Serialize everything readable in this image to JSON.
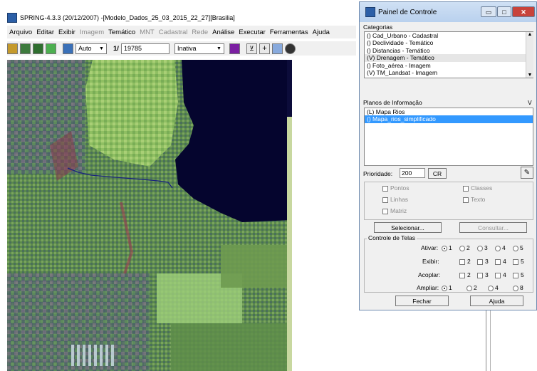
{
  "main_window": {
    "title": "SPRING-4.3.3 (20/12/2007) -[Modelo_Dados_25_03_2015_22_27][Brasilia]",
    "menu": [
      {
        "label": "Arquivo",
        "enabled": true
      },
      {
        "label": "Editar",
        "enabled": true
      },
      {
        "label": "Exibir",
        "enabled": true
      },
      {
        "label": "Imagem",
        "enabled": false
      },
      {
        "label": "Temático",
        "enabled": true
      },
      {
        "label": "MNT",
        "enabled": false
      },
      {
        "label": "Cadastral",
        "enabled": false
      },
      {
        "label": "Rede",
        "enabled": false
      },
      {
        "label": "Análise",
        "enabled": true
      },
      {
        "label": "Executar",
        "enabled": true
      },
      {
        "label": "Ferramentas",
        "enabled": true
      },
      {
        "label": "Ajuda",
        "enabled": true
      }
    ],
    "toolbar": {
      "zoom_mode": "Auto",
      "scale_prefix": "1/",
      "scale_value": "19785",
      "cursor_mode": "Inativa"
    }
  },
  "control_panel": {
    "title": "Painel de Controle",
    "categorias_label": "Categorias",
    "categorias": [
      "() Cad_Urbano - Cadastral",
      "() Declividade - Temático",
      "() Distancias - Temático",
      "(V) Drenagem - Temático",
      "() Foto_aérea - Imagem",
      "(V) TM_Landsat - Imagem"
    ],
    "planos_label": "Planos de Informação",
    "planos_v": "V",
    "planos": [
      "(L) Mapa Rios",
      "() Mapa_rios_simplificado"
    ],
    "selected_plano": 1,
    "prioridade_label": "Prioridade:",
    "prioridade_value": "200",
    "cr_label": "CR",
    "checks": {
      "pontos": "Pontos",
      "classes": "Classes",
      "linhas": "Linhas",
      "texto": "Texto",
      "matriz": "Matriz"
    },
    "selecionar_label": "Selecionar...",
    "consultar_label": "Consultar...",
    "controle_label": "Controle de Telas",
    "ativar_label": "Ativar:",
    "exibir_label": "Exibir:",
    "acoplar_label": "Acoplar:",
    "ampliar_label": "Ampliar:",
    "ativar_options": [
      "1",
      "2",
      "3",
      "4",
      "5"
    ],
    "exibir_options": [
      "2",
      "3",
      "4",
      "5"
    ],
    "acoplar_options": [
      "2",
      "3",
      "4",
      "5"
    ],
    "ampliar_options": [
      "1",
      "2",
      "4",
      "8"
    ],
    "fechar_label": "Fechar",
    "ajuda_label": "Ajuda"
  },
  "colors": {
    "selection": "#3399ff",
    "water": "#05052e",
    "river_line": "#1a237e"
  }
}
